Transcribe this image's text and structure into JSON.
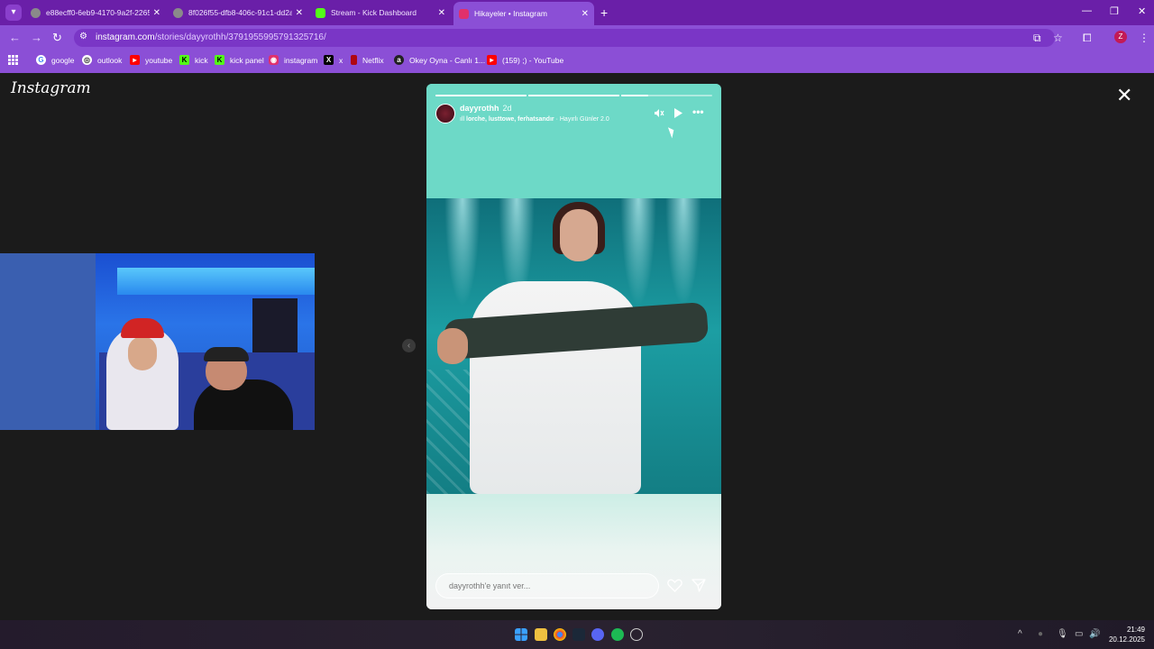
{
  "browser": {
    "tabs": [
      {
        "title": "e88ecff0-6eb9-4170-9a2f-2265",
        "favicon_color": "#8a8a8a",
        "active": false
      },
      {
        "title": "8f026f55-dfb8-406c-91c1-dd2a",
        "favicon_color": "#8a8a8a",
        "active": false
      },
      {
        "title": "Stream - Kick Dashboard",
        "favicon_color": "#53fc18",
        "active": false
      },
      {
        "title": "Hikayeler • Instagram",
        "favicon_color": "#e1306c",
        "active": true
      }
    ],
    "url_host": "instagram.com",
    "url_path": "/stories/dayyrothh/3791955995791325716/",
    "profile_initial": "Z",
    "bookmarks": [
      {
        "label": "google",
        "icon": "google-icon",
        "color": "#ffffff"
      },
      {
        "label": "outlook",
        "icon": "outlook-icon",
        "color": "#ffffff"
      },
      {
        "label": "youtube",
        "icon": "youtube-icon",
        "color": "#ff0000"
      },
      {
        "label": "kick",
        "icon": "kick-icon",
        "color": "#53fc18"
      },
      {
        "label": "kick panel",
        "icon": "kick-icon",
        "color": "#53fc18"
      },
      {
        "label": "instagram",
        "icon": "instagram-icon",
        "color": "#e1306c"
      },
      {
        "label": "x",
        "icon": "x-icon",
        "color": "#000000"
      },
      {
        "label": "Netflix",
        "icon": "netflix-icon",
        "color": "#b00710"
      },
      {
        "label": "Okey Oyna - Canlı 1...",
        "icon": "okey-icon",
        "color": "#222222"
      },
      {
        "label": "(159) ;) - YouTube",
        "icon": "youtube-icon",
        "color": "#ff0000"
      }
    ]
  },
  "page": {
    "logo": "Instagram"
  },
  "story": {
    "username": "dayyrothh",
    "age": "2d",
    "music_artists": "lorche, lusttowe, ferhatsandır",
    "music_title": "Hayırlı Günler 2.0",
    "progress_segments": [
      1.0,
      1.0,
      0.3,
      0.0
    ],
    "reply_placeholder": "dayyrothh'e yanıt ver..."
  },
  "taskbar": {
    "time": "21:49",
    "date": "20.12.2025"
  },
  "colors": {
    "chrome_purple": "#8b4fd6",
    "tabstrip_purple": "#6a1fa8",
    "story_teal": "#6dd9c7"
  }
}
